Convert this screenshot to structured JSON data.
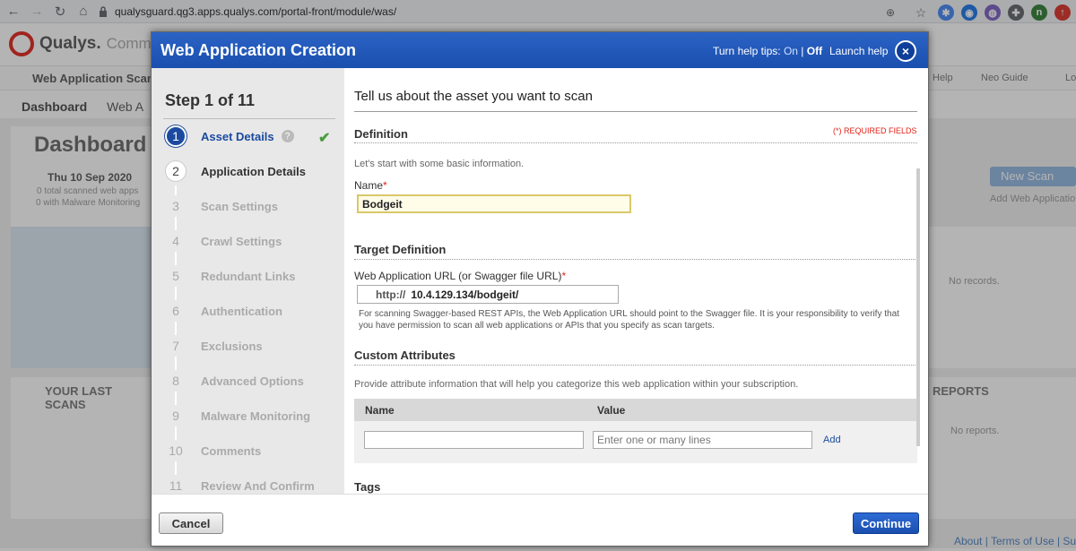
{
  "browser": {
    "url": "qualysguard.qg3.apps.qualys.com/portal-front/module/was/",
    "profile_initial": "n"
  },
  "background": {
    "brand": "Qualys.",
    "brand_sub": "Comm",
    "app_name": "Web Application Scan",
    "help_menu": "Help",
    "guide_menu": "Neo Guide",
    "logout": "Lo",
    "tabs": [
      "Dashboard",
      "Web A"
    ],
    "dashboard_title": "Dashboard",
    "date": "Thu 10 Sep 2020",
    "stat1": "0 total scanned web apps",
    "stat2": "0 with Malware Monitoring",
    "last_scans": "YOUR LAST SCANS",
    "reports": "REPORTS",
    "new_scan": "New Scan",
    "add_web_app": "Add Web Application",
    "no_records": "No records.",
    "no_reports": "No reports.",
    "footer_about": "About",
    "footer_terms": "Terms of Use",
    "footer_sup": "Sup"
  },
  "modal": {
    "title": "Web Application Creation",
    "help_tips_label": "Turn help tips:",
    "help_on": "On",
    "help_sep": "|",
    "help_off": "Off",
    "launch_help": "Launch help",
    "close": "×"
  },
  "steps": {
    "heading": "Step 1 of 11",
    "items": [
      {
        "num": "1",
        "label": "Asset Details"
      },
      {
        "num": "2",
        "label": "Application Details"
      },
      {
        "num": "3",
        "label": "Scan Settings"
      },
      {
        "num": "4",
        "label": "Crawl Settings"
      },
      {
        "num": "5",
        "label": "Redundant Links"
      },
      {
        "num": "6",
        "label": "Authentication"
      },
      {
        "num": "7",
        "label": "Exclusions"
      },
      {
        "num": "8",
        "label": "Advanced Options"
      },
      {
        "num": "9",
        "label": "Malware Monitoring"
      },
      {
        "num": "10",
        "label": "Comments"
      },
      {
        "num": "11",
        "label": "Review And Confirm"
      }
    ]
  },
  "form": {
    "title": "Tell us about the asset you want to scan",
    "definition_heading": "Definition",
    "required_note": "(*) REQUIRED FIELDS",
    "definition_hint": "Let's start with some basic information.",
    "name_label": "Name",
    "name_value": "Bodgeit",
    "target_heading": "Target Definition",
    "url_label": "Web Application URL (or Swagger file URL)",
    "url_prefix": "http://",
    "url_value": "10.4.129.134/bodgeit/",
    "url_help": "For scanning Swagger-based REST APIs, the Web Application URL should point to the Swagger file. It is your responsibility to verify that you have permission to scan all web applications or APIs that you specify as scan targets.",
    "custom_heading": "Custom Attributes",
    "custom_hint": "Provide attribute information that will help you categorize this web application within your subscription.",
    "col_name": "Name",
    "col_value": "Value",
    "value_placeholder": "Enter one or many lines",
    "add_link": "Add",
    "tags_heading": "Tags"
  },
  "footer": {
    "cancel": "Cancel",
    "continue": "Continue"
  },
  "colors": {
    "header_blue": "#1a4fae",
    "brand_red": "#e2231a",
    "check_green": "#4a9c3f"
  }
}
